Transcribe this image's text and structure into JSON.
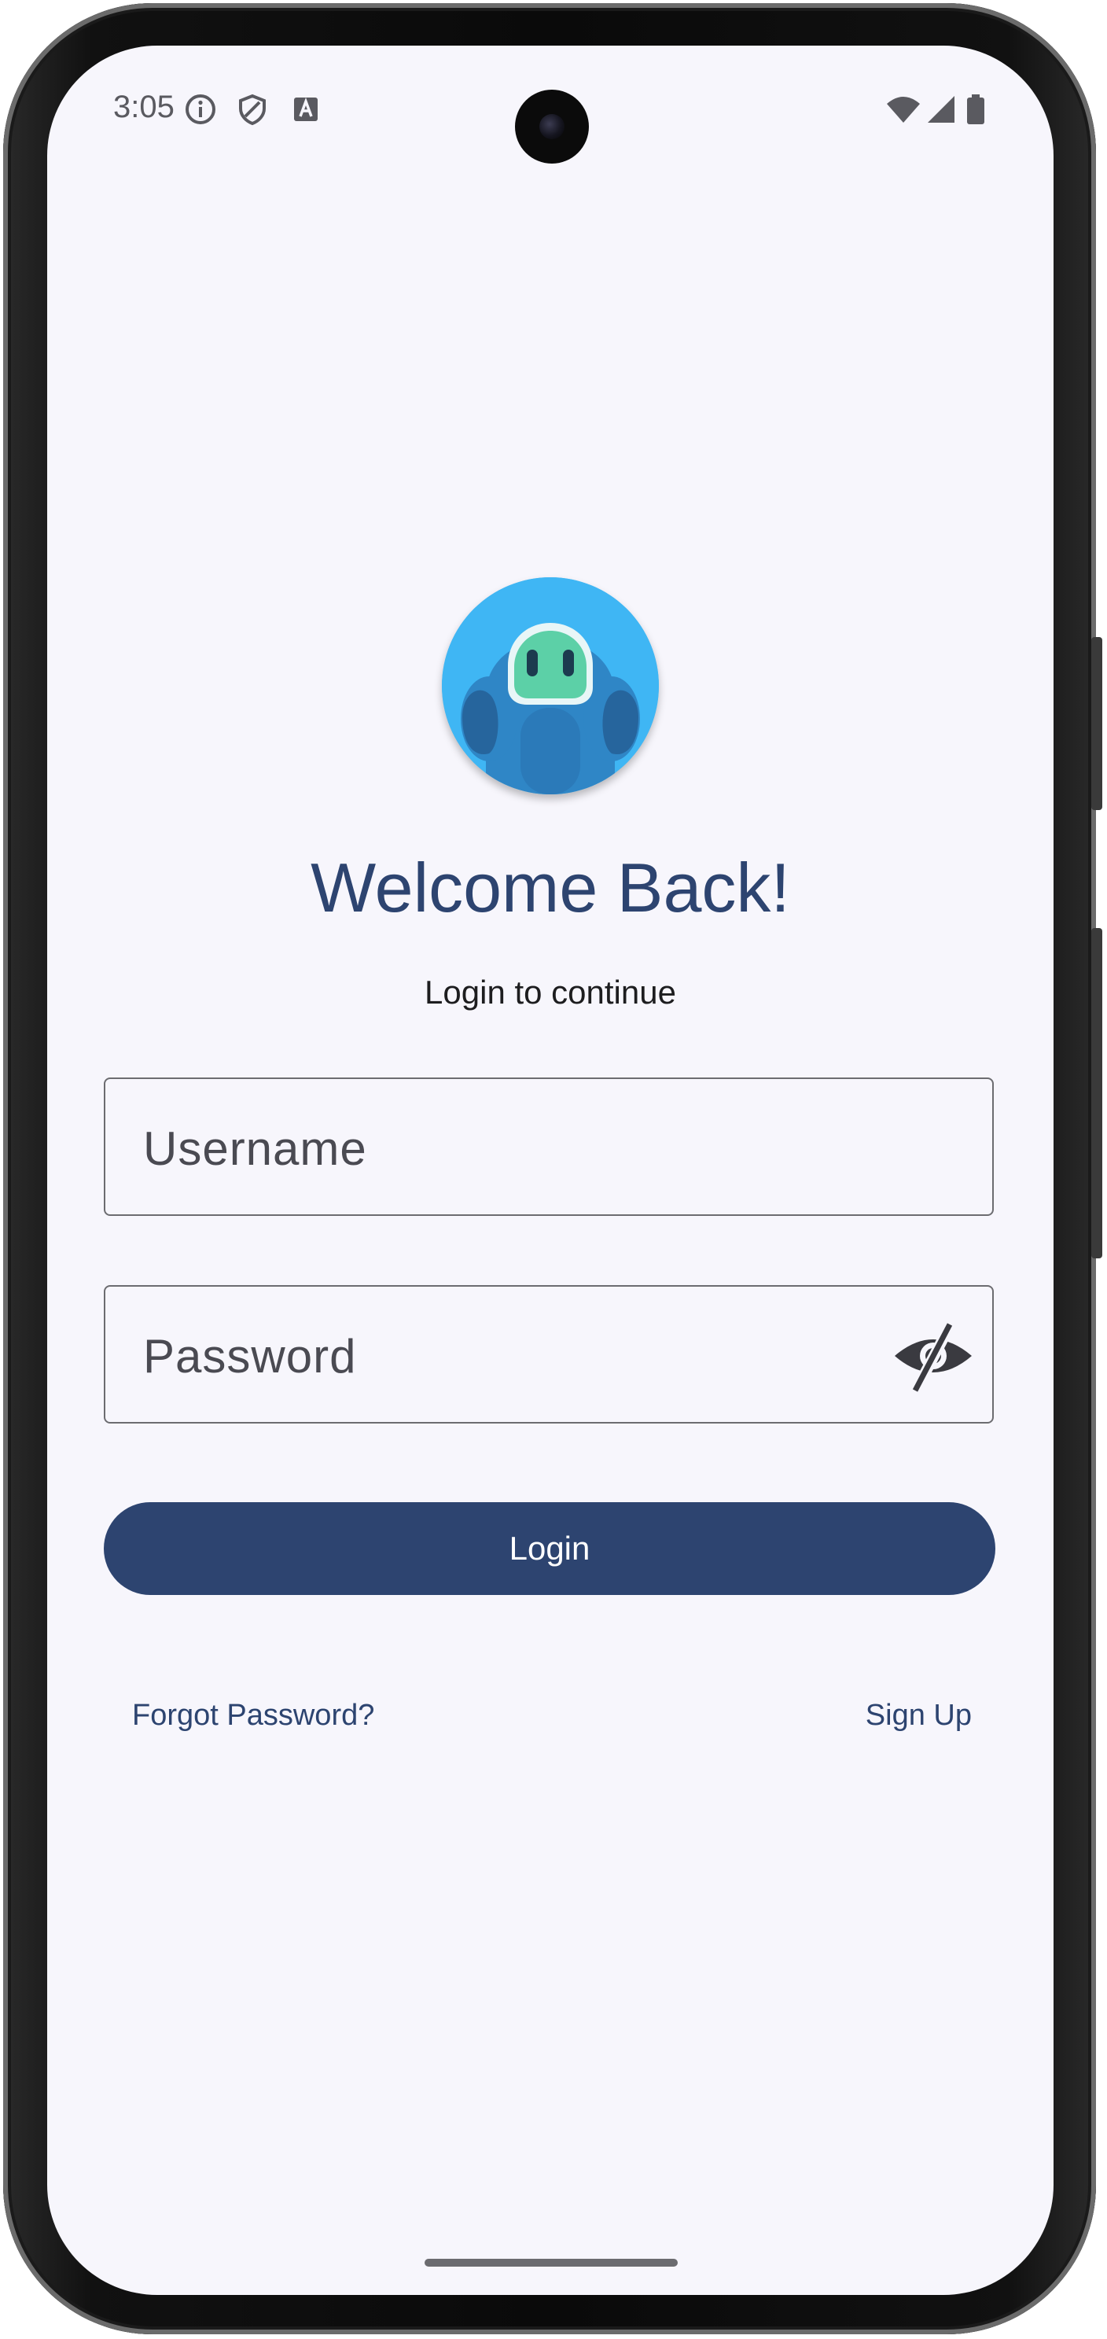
{
  "status_bar": {
    "time": "3:05",
    "icons": [
      "info-icon",
      "shield-icon",
      "text-a-icon",
      "wifi-icon",
      "signal-icon",
      "battery-icon"
    ]
  },
  "login": {
    "title": "Welcome Back!",
    "subtitle": "Login to continue",
    "username_placeholder": "Username",
    "password_placeholder": "Password",
    "login_label": "Login",
    "forgot_label": "Forgot Password?",
    "signup_label": "Sign Up"
  },
  "colors": {
    "primary": "#2d4470",
    "background": "#f7f6fc",
    "avatar_bg": "#3fb6f4"
  }
}
